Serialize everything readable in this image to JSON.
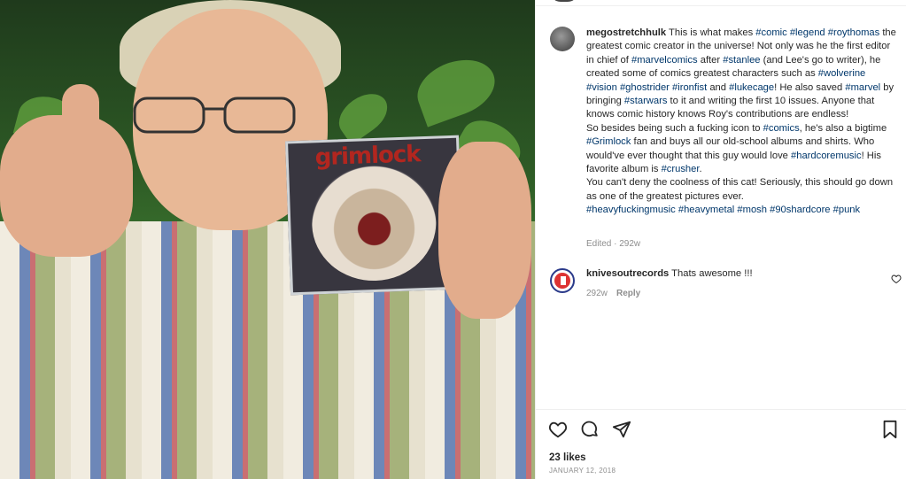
{
  "post": {
    "caption_user": "megostretchhulk",
    "caption_parts": [
      {
        "t": " This is what makes "
      },
      {
        "tag": "#comic"
      },
      {
        "t": " "
      },
      {
        "tag": "#legend"
      },
      {
        "t": " "
      },
      {
        "tag": "#roythomas"
      },
      {
        "t": " the greatest comic creator in the universe! Not only was he the first editor in chief of "
      },
      {
        "tag": "#marvelcomics"
      },
      {
        "t": " after "
      },
      {
        "tag": "#stanlee"
      },
      {
        "t": " (and Lee's go to writer), he created some of comics greatest characters such as "
      },
      {
        "tag": "#wolverine"
      },
      {
        "t": " "
      },
      {
        "tag": "#vision"
      },
      {
        "t": " "
      },
      {
        "tag": "#ghostrider"
      },
      {
        "t": " "
      },
      {
        "tag": "#ironfist"
      },
      {
        "t": " and "
      },
      {
        "tag": "#lukecage"
      },
      {
        "t": "! He also saved "
      },
      {
        "tag": "#marvel"
      },
      {
        "t": " by bringing "
      },
      {
        "tag": "#starwars"
      },
      {
        "t": " to it and writing the first 10 issues. Anyone that knows comic history knows Roy's contributions are endless!"
      },
      {
        "br": true
      },
      {
        "t": "So besides being such a fucking icon to "
      },
      {
        "tag": "#comics"
      },
      {
        "t": ", he's also a bigtime "
      },
      {
        "tag": "#Grimlock"
      },
      {
        "t": " fan and buys all our old-school albums and shirts. Who would've ever thought that this guy would love "
      },
      {
        "tag": "#hardcoremusic"
      },
      {
        "t": "! His favorite album is "
      },
      {
        "tag": "#crusher"
      },
      {
        "t": "."
      },
      {
        "br": true
      },
      {
        "t": "You can't deny the coolness of this cat! Seriously, this should go down as one of the greatest pictures ever."
      },
      {
        "br": true
      },
      {
        "tag": "#heavyfuckingmusic"
      },
      {
        "t": " "
      },
      {
        "tag": "#heavymetal"
      },
      {
        "t": " "
      },
      {
        "tag": "#mosh"
      },
      {
        "t": " "
      },
      {
        "tag": "#90shardcore"
      },
      {
        "t": " "
      },
      {
        "tag": "#punk"
      }
    ],
    "caption_meta": "Edited · 292w",
    "album_title": "grimlock",
    "likes": "23 likes",
    "date": "JANUARY 12, 2018"
  },
  "comment": {
    "user": "knivesoutrecords",
    "text": " Thats awesome !!!",
    "age": "292w",
    "reply_label": "Reply"
  },
  "icons": {
    "like": "heart-icon",
    "comment": "comment-icon",
    "share": "paper-plane-icon",
    "save": "bookmark-icon"
  },
  "colors": {
    "hashtag": "#00376b",
    "meta": "#8e8e8e",
    "text": "#262626"
  }
}
